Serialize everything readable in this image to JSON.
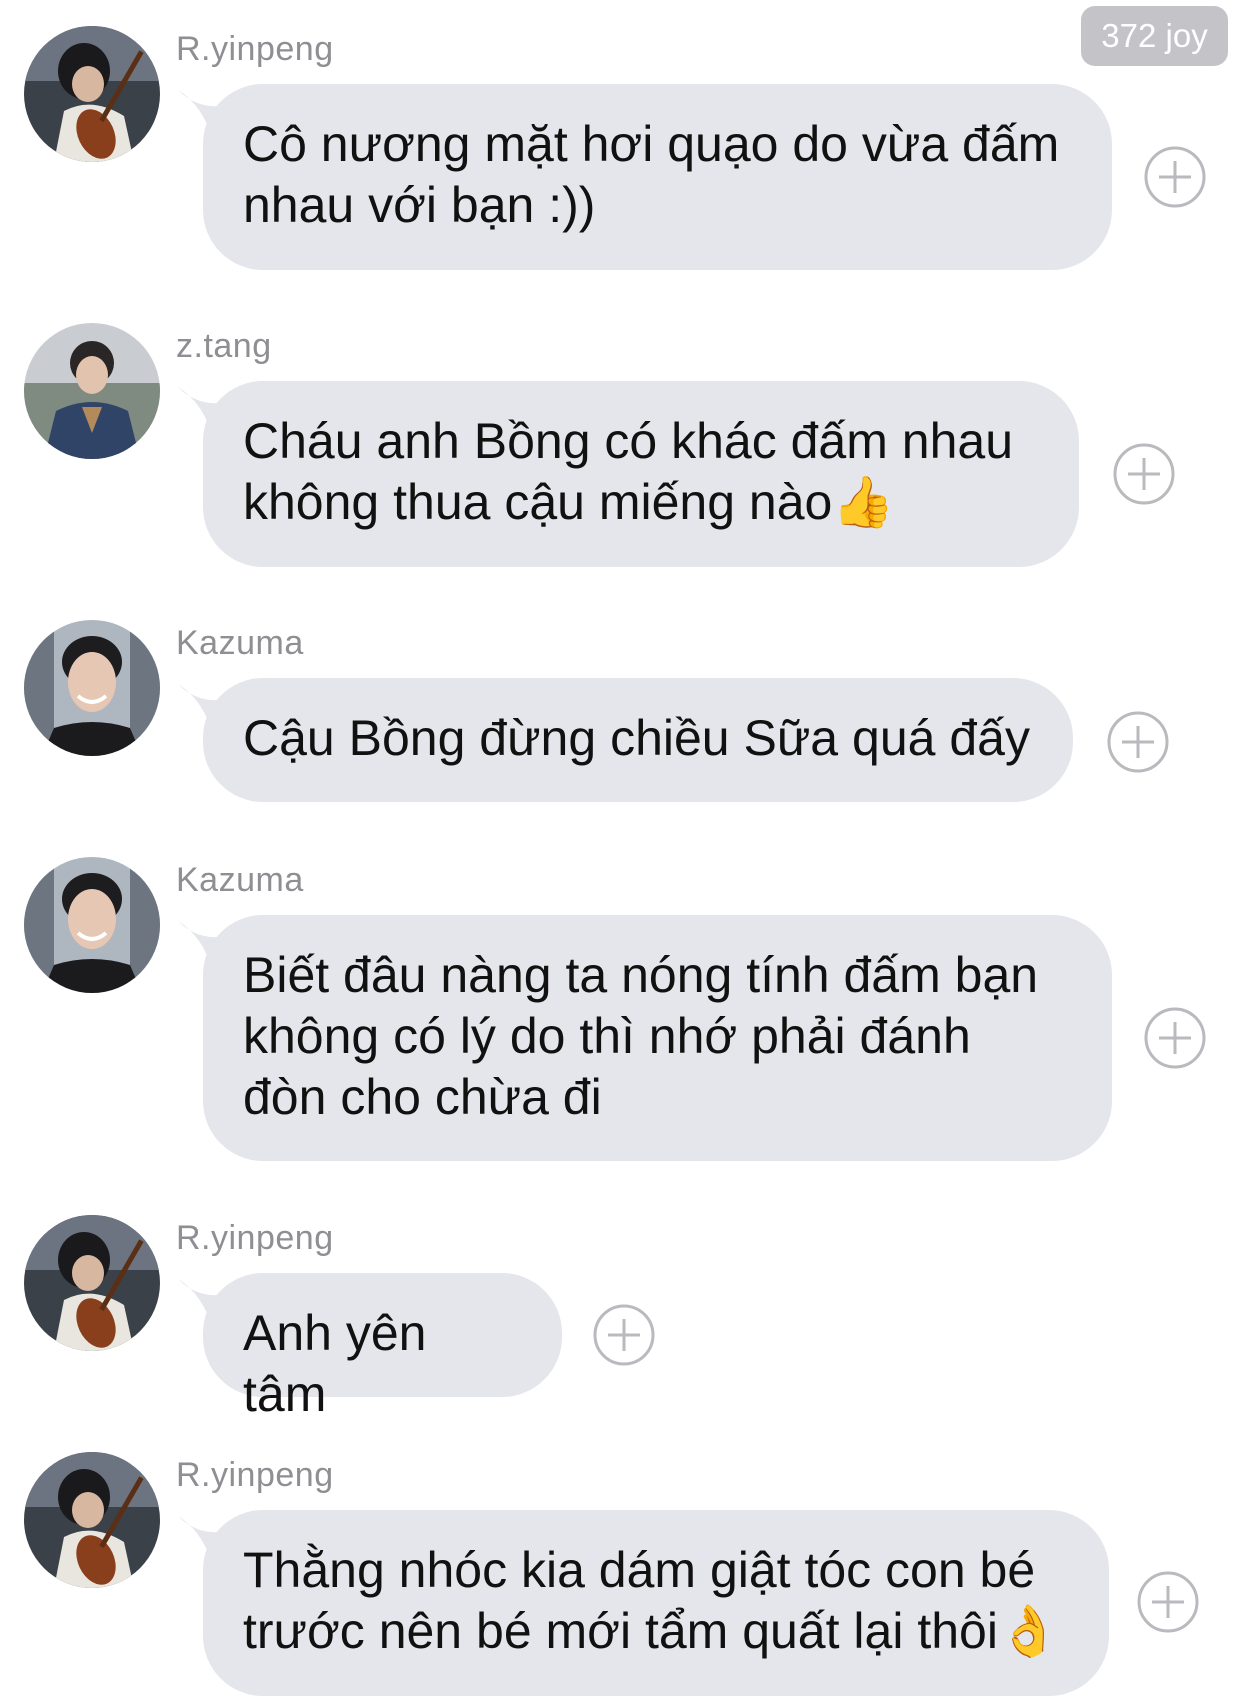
{
  "header": {
    "badge": "372 joy"
  },
  "messages": [
    {
      "sender": "R.yinpeng",
      "avatar_icon": "cello-player-avatar-icon",
      "lines": [
        "Cô nương mặt hơi quạo do vừa đấm",
        "nhau với bạn :))"
      ]
    },
    {
      "sender": "z.tang",
      "avatar_icon": "man-in-jacket-avatar-icon",
      "lines": [
        "Cháu anh Bồng có khác đấm nhau",
        "không thua cậu miếng nào👍"
      ]
    },
    {
      "sender": "Kazuma",
      "avatar_icon": "smiling-man-avatar-icon",
      "lines": [
        "Cậu Bồng đừng chiều Sữa quá đấy"
      ]
    },
    {
      "sender": "Kazuma",
      "avatar_icon": "smiling-man-avatar-icon",
      "lines": [
        "Biết đâu nàng ta nóng tính đấm bạn",
        "không có lý do thì nhớ phải đánh",
        "đòn cho chừa đi"
      ]
    },
    {
      "sender": "R.yinpeng",
      "avatar_icon": "cello-player-avatar-icon",
      "lines": [
        "Anh yên tâm"
      ]
    },
    {
      "sender": "R.yinpeng",
      "avatar_icon": "cello-player-avatar-icon",
      "lines": [
        "Thằng nhóc kia dám giật tóc con bé",
        "trước nên bé mới tẩm quất lại thôi👌"
      ]
    }
  ],
  "colors": {
    "bubble": "#e5e6eb",
    "badge": "#c3c3c8",
    "sender": "#8e8e93",
    "add_icon": "#b9b9be"
  }
}
